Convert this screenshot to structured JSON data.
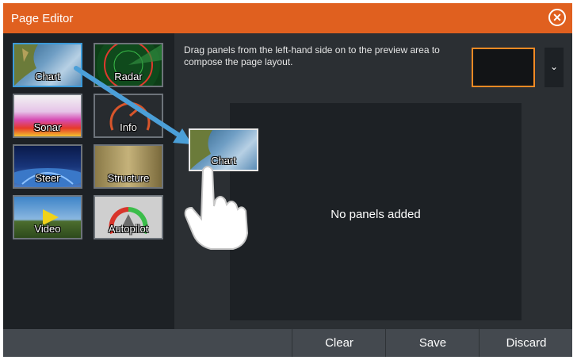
{
  "window": {
    "title": "Page Editor"
  },
  "icons": {
    "close": "close-circle-icon",
    "dropdown": "chevron-down-icon",
    "hand": "pointing-hand-icon",
    "arrow": "drag-arrow-icon"
  },
  "palette": {
    "tiles": [
      {
        "label": "Chart",
        "selected": true
      },
      {
        "label": "Radar",
        "selected": false
      },
      {
        "label": "Sonar",
        "selected": false
      },
      {
        "label": "Info",
        "selected": false
      },
      {
        "label": "Steer",
        "selected": false
      },
      {
        "label": "Structure",
        "selected": false
      },
      {
        "label": "Video",
        "selected": false
      },
      {
        "label": "Autopilot",
        "selected": false
      }
    ]
  },
  "preview": {
    "instructions": "Drag panels from the left-hand side on to the preview area to compose the page layout.",
    "empty_text": "No panels added",
    "dragging_label": "Chart"
  },
  "actions": {
    "clear": "Clear",
    "save": "Save",
    "discard": "Discard"
  },
  "colors": {
    "title_bar": "#e0601f",
    "selection": "#3b9ad9",
    "layout_border": "#f28a24",
    "arrow": "#4b9fd8"
  }
}
